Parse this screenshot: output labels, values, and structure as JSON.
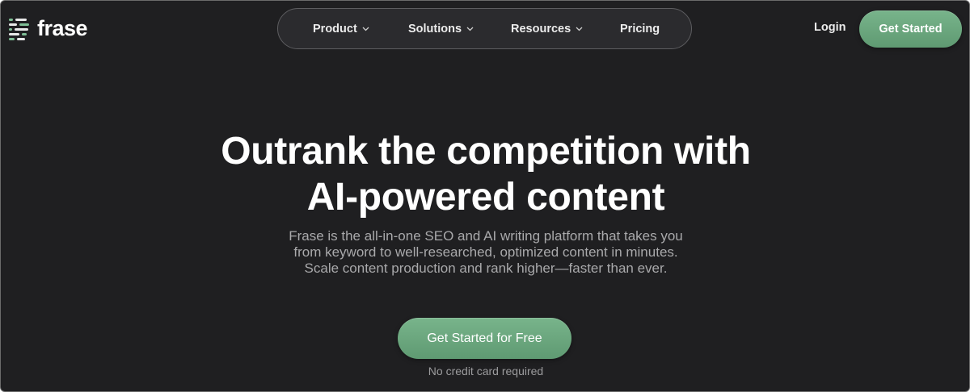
{
  "header": {
    "logo_text": "frase",
    "nav": [
      {
        "label": "Product",
        "has_dropdown": true
      },
      {
        "label": "Solutions",
        "has_dropdown": true
      },
      {
        "label": "Resources",
        "has_dropdown": true
      },
      {
        "label": "Pricing",
        "has_dropdown": false
      }
    ],
    "login_label": "Login",
    "cta_label": "Get Started"
  },
  "hero": {
    "headline_line1": "Outrank the competition with",
    "headline_line2": "AI-powered content",
    "subtext_line1": "Frase is the all-in-one SEO and AI writing platform that takes you",
    "subtext_line2": "from keyword to well-researched, optimized content in minutes.",
    "subtext_line3": "Scale content production and rank higher—faster than ever.",
    "cta_label": "Get Started for Free",
    "note": "No credit card required"
  },
  "colors": {
    "background": "#1f1f21",
    "accent_green": "#6aa77e",
    "text_primary": "#ffffff",
    "text_muted": "#a9a9ab"
  }
}
